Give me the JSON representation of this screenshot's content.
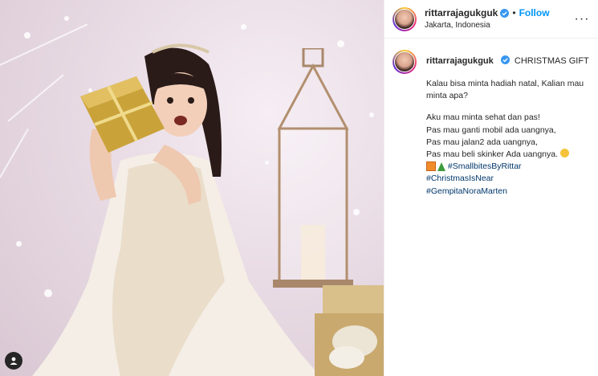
{
  "header": {
    "username": "rittarrajagukguk",
    "separator": "•",
    "follow_label": "Follow",
    "location": "Jakarta, Indonesia",
    "more_label": "···"
  },
  "caption": {
    "username": "rittarrajagukguk",
    "title": "CHRISTMAS GIFT",
    "line1": "Kalau bisa minta hadiah natal, Kalian mau minta apa?",
    "line2": "Aku mau minta sehat dan pas!",
    "line3": "Pas mau ganti mobil ada uangnya,",
    "line4": "Pas mau jalan2 ada uangnya,",
    "line5": "Pas mau beli skinker Ada uangnya.",
    "hashtags": [
      "#SmallbitesByRittar",
      "#ChristmasIsNear",
      "#GempitaNoraMarten"
    ]
  },
  "icons": {
    "verified": "verified-badge-icon",
    "user_tag": "user-tag-icon",
    "more": "more-options-icon"
  },
  "colors": {
    "link": "#00376b",
    "follow": "#0095f6",
    "verified": "#3897f0",
    "text": "#262626"
  }
}
